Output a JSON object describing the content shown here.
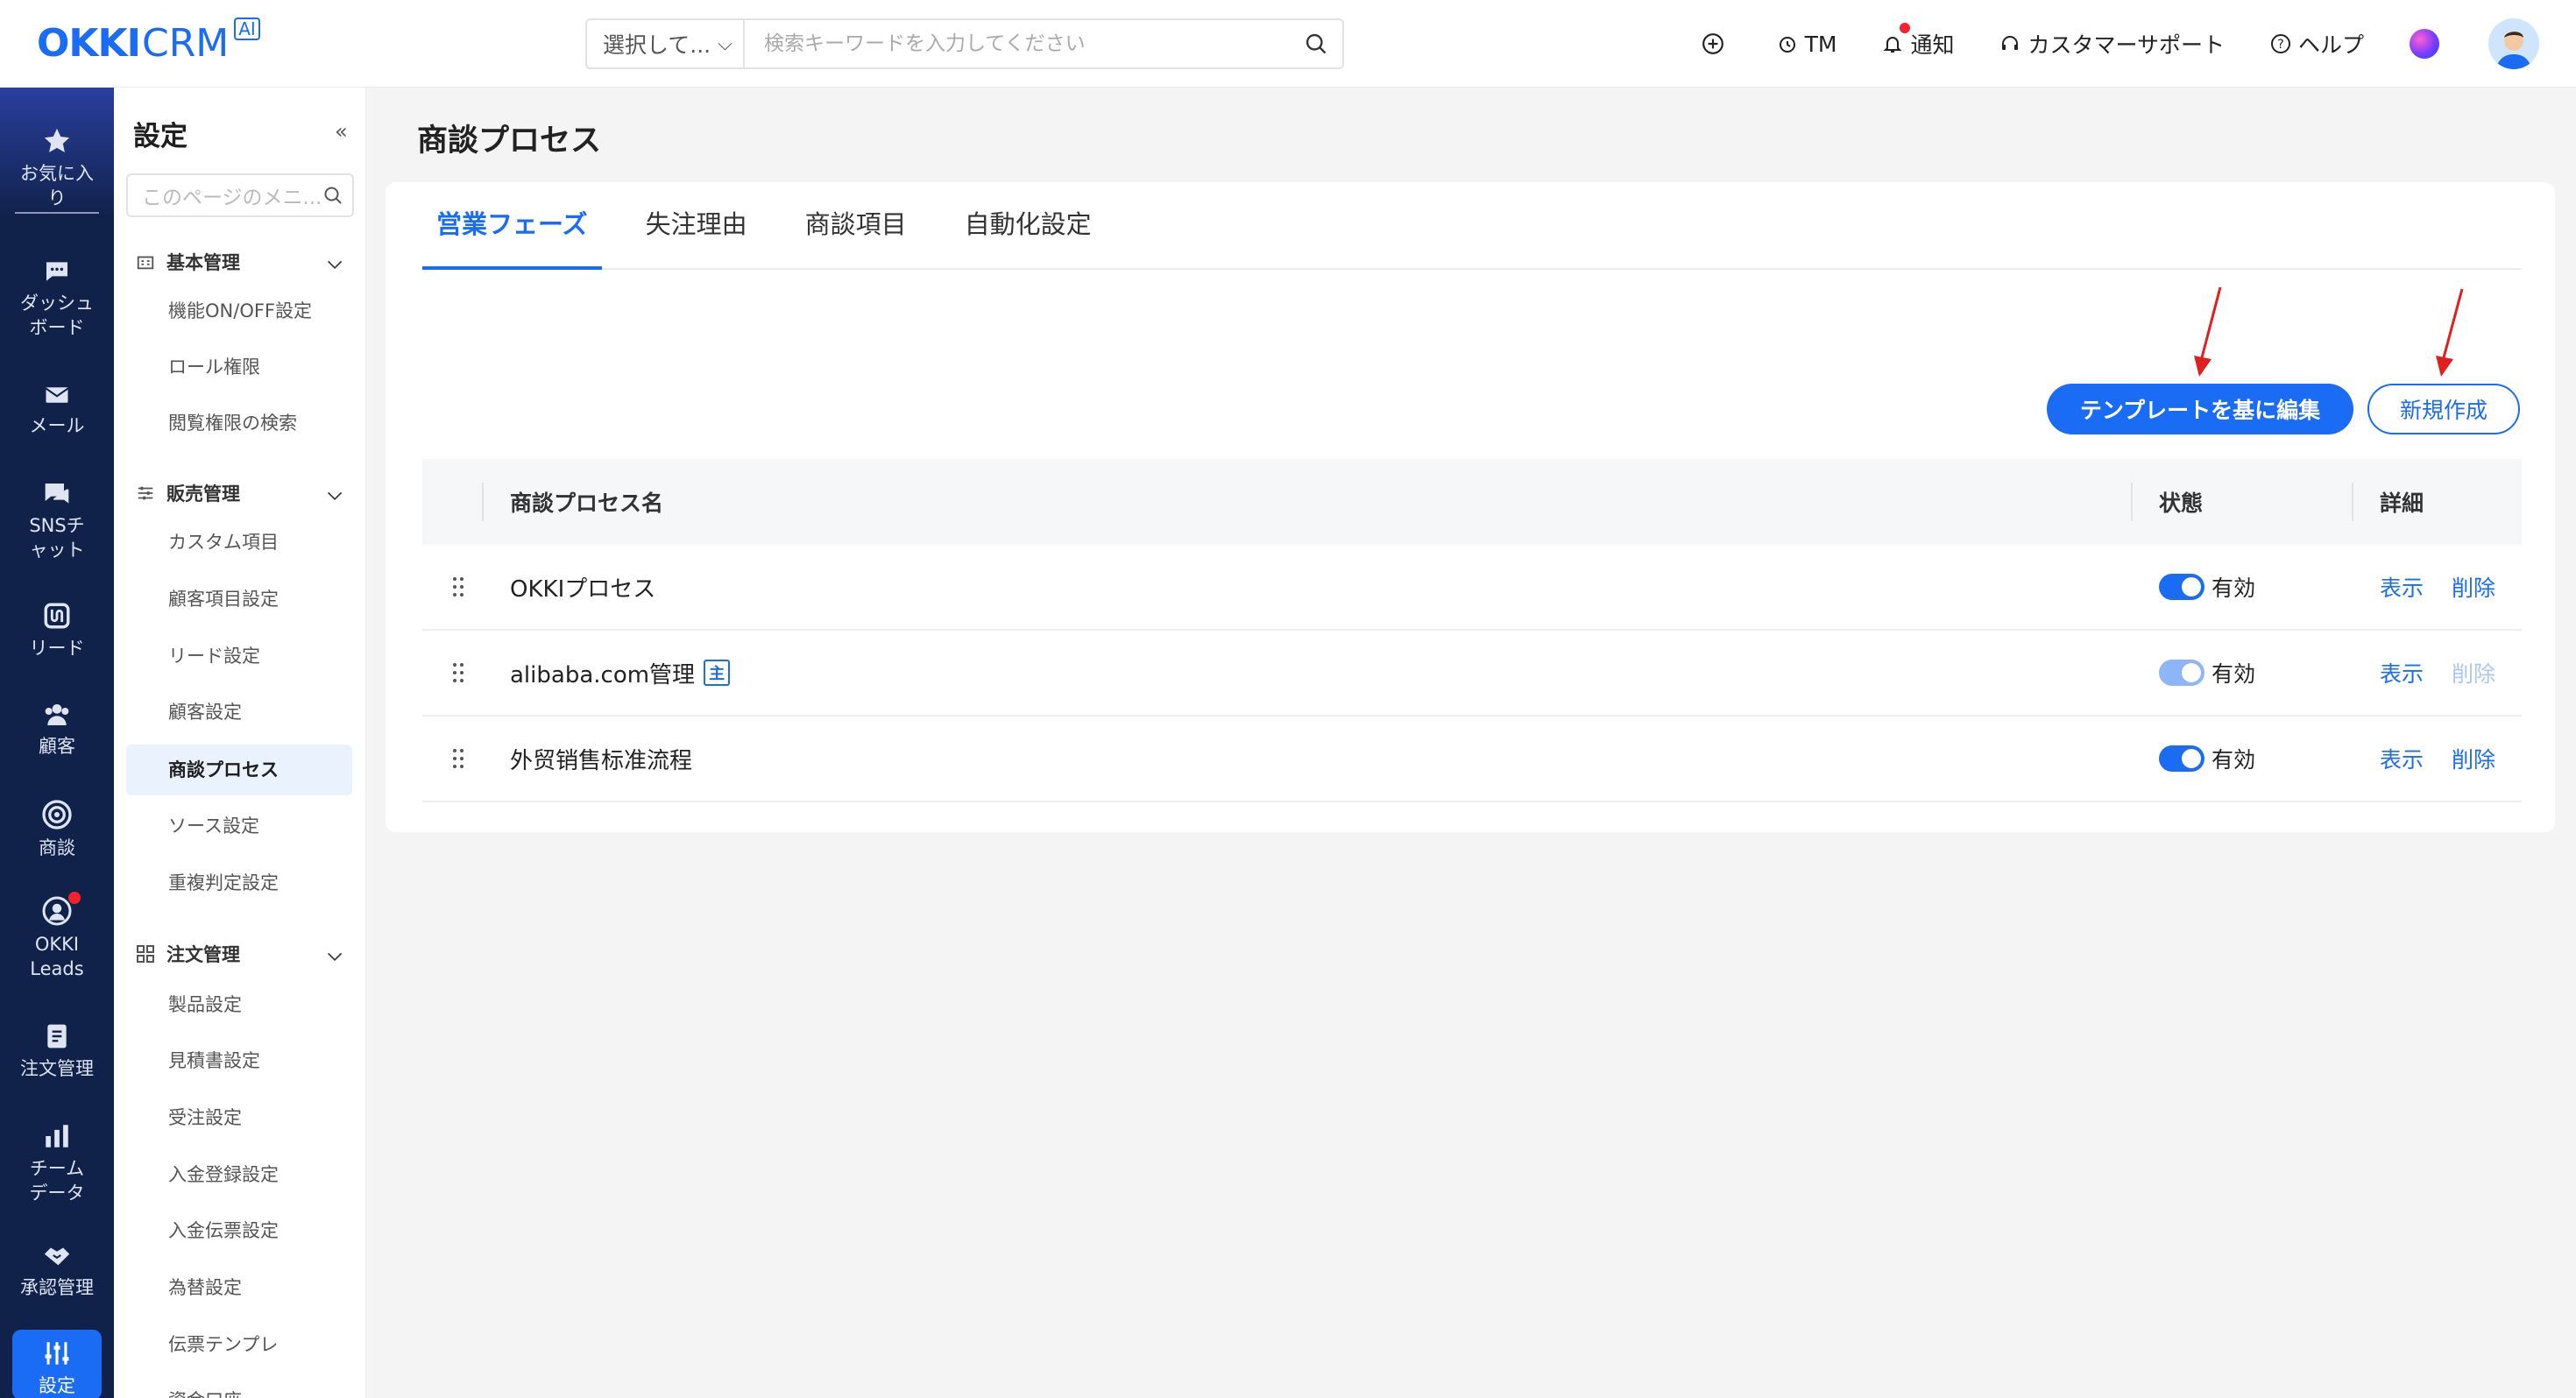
{
  "header": {
    "logo_main": "OKKI",
    "logo_crm": "CRM",
    "logo_ai": "AI",
    "search_select": "選択して...",
    "search_placeholder": "検索キーワードを入力してください",
    "tm": "TM",
    "notify": "通知",
    "support": "カスタマーサポート",
    "help": "ヘルプ"
  },
  "nav": {
    "items": [
      {
        "label": "お気に入り",
        "icon": "star-icon"
      },
      {
        "label": "ダッシュボード",
        "icon": "chat-bubble-icon"
      },
      {
        "label": "メール",
        "icon": "mail-icon"
      },
      {
        "label": "SNSチャット",
        "icon": "sns-chat-icon"
      },
      {
        "label": "リード",
        "icon": "lead-icon"
      },
      {
        "label": "顧客",
        "icon": "customers-icon"
      },
      {
        "label": "商談",
        "icon": "target-icon"
      },
      {
        "label": "OKKI Leads",
        "icon": "okki-leads-icon"
      },
      {
        "label": "注文管理",
        "icon": "order-icon"
      },
      {
        "label": "チームデータ",
        "icon": "bar-chart-icon"
      },
      {
        "label": "承認管理",
        "icon": "handshake-icon"
      },
      {
        "label": "設定",
        "icon": "settings-sliders-icon"
      }
    ]
  },
  "settings_menu": {
    "title": "設定",
    "collapse": "«",
    "search_placeholder": "このページのメニ...",
    "groups": [
      {
        "label": "基本管理",
        "items": [
          "機能ON/OFF設定",
          "ロール権限",
          "閲覧権限の検索"
        ]
      },
      {
        "label": "販売管理",
        "items": [
          "カスタム項目",
          "顧客項目設定",
          "リード設定",
          "顧客設定",
          "商談プロセス",
          "ソース設定",
          "重複判定設定"
        ]
      },
      {
        "label": "注文管理",
        "items": [
          "製品設定",
          "見積書設定",
          "受注設定",
          "入金登録設定",
          "入金伝票設定",
          "為替設定",
          "伝票テンプレ",
          "資金口座"
        ]
      }
    ]
  },
  "page": {
    "title": "商談プロセス",
    "tabs": [
      "営業フェーズ",
      "失注理由",
      "商談項目",
      "自動化設定"
    ],
    "btn_template": "テンプレートを基に編集",
    "btn_new": "新規作成",
    "table": {
      "col_name": "商談プロセス名",
      "col_status": "状態",
      "col_detail": "詳細",
      "rows": [
        {
          "name": "OKKIプロセス",
          "badge": "",
          "status": "有効",
          "view": "表示",
          "delete": "削除",
          "toggle_dim": false,
          "delete_disabled": false
        },
        {
          "name": "alibaba.com管理",
          "badge": "主",
          "status": "有効",
          "view": "表示",
          "delete": "削除",
          "toggle_dim": true,
          "delete_disabled": true
        },
        {
          "name": "外贸销售标准流程",
          "badge": "",
          "status": "有効",
          "view": "表示",
          "delete": "削除",
          "toggle_dim": false,
          "delete_disabled": false
        }
      ]
    }
  },
  "colors": {
    "accent": "#1a6cf5",
    "nav_bg": "#10214a",
    "annotation_arrow": "#e02020"
  }
}
